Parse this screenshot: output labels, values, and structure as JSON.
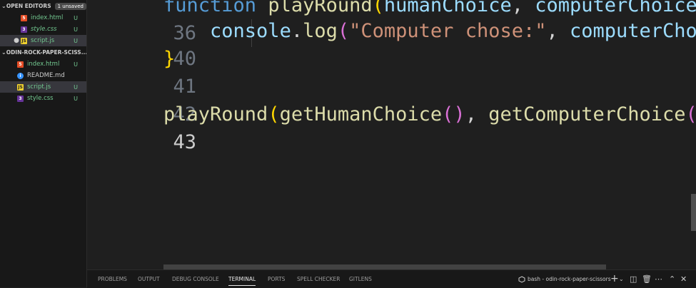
{
  "sidebar": {
    "open_editors": {
      "title": "OPEN EDITORS",
      "badge": "1 unsaved",
      "items": [
        {
          "name": "index.html",
          "status": "U"
        },
        {
          "name": "style.css",
          "status": "U"
        },
        {
          "name": "script.js",
          "status": "U"
        }
      ]
    },
    "folder": {
      "title": "ODIN-ROCK-PAPER-SCISS...",
      "items": [
        {
          "name": "index.html",
          "status": "U"
        },
        {
          "name": "README.md"
        },
        {
          "name": "script.js",
          "status": "U"
        },
        {
          "name": "style.css",
          "status": "U"
        }
      ]
    }
  },
  "editor": {
    "lines": [
      {
        "number": "36",
        "tokens": [
          "function",
          " ",
          "playRound",
          "(",
          "humanChoice",
          ", ",
          "computerChoice"
        ]
      },
      {
        "number": "40",
        "tokens": [
          "    ",
          "console",
          ".",
          "log",
          "(",
          "\"Computer chose:\"",
          ", ",
          "computerChoi"
        ]
      },
      {
        "number": "41",
        "tokens": [
          "}"
        ]
      },
      {
        "number": "42",
        "tokens": []
      },
      {
        "number": "43",
        "tokens": [
          "playRound",
          "(",
          "getHumanChoice",
          "(",
          ")",
          ", ",
          "getComputerChoice",
          "(",
          ")"
        ]
      }
    ]
  },
  "panel": {
    "tabs": [
      "PROBLEMS",
      "OUTPUT",
      "DEBUG CONSOLE",
      "TERMINAL",
      "PORTS",
      "SPELL CHECKER",
      "GITLENS"
    ],
    "active_tab": "TERMINAL",
    "terminal_name": "bash - odin-rock-paper-scissors"
  },
  "colors": {
    "accent": "#0078d4",
    "git_untracked": "#73c991"
  }
}
